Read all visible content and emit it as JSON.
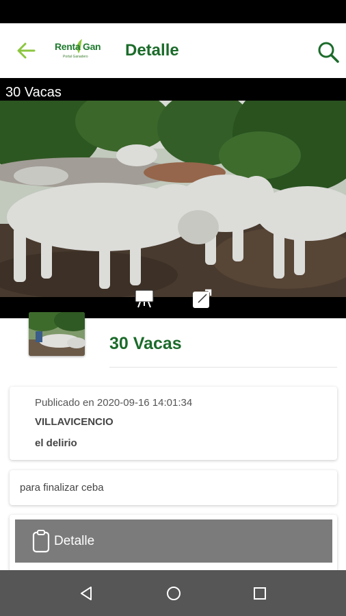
{
  "app_bar": {
    "back_icon": "arrow-left-icon",
    "logo_text": "Renta Gan",
    "logo_subtext": "Portal Ganadero",
    "title": "Detalle",
    "search_icon": "search-icon",
    "accent_color": "#1b6b2a",
    "back_color": "#8cc63f"
  },
  "media": {
    "title": "30 Vacas",
    "controls": [
      "presentation-icon",
      "open-external-icon"
    ]
  },
  "listing": {
    "title": "30 Vacas",
    "published": "Publicado en 2020-09-16 14:01:34",
    "city": "VILLAVICENCIO",
    "place": "el delirio",
    "description": "para finalizar ceba",
    "detail_label": "Detalle",
    "detail_icon": "clipboard-icon"
  },
  "nav": {
    "back": "nav-back-icon",
    "home": "nav-home-icon",
    "recents": "nav-recents-icon"
  }
}
